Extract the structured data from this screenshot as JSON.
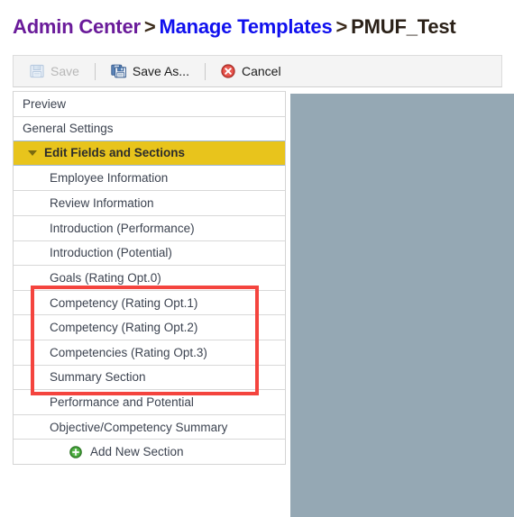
{
  "breadcrumb": {
    "root": "Admin Center",
    "separator": ">",
    "middle": "Manage Templates",
    "current": "PMUF_Test",
    "colors": {
      "root": "#6a1b9a",
      "middle": "#1010ee",
      "current": "#2b2118"
    }
  },
  "toolbar": {
    "save_label": "Save",
    "save_enabled": "false",
    "save_as_label": "Save As...",
    "cancel_label": "Cancel",
    "icons": {
      "save": "floppy-disk-icon",
      "save_as": "double-floppy-disk-icon",
      "cancel": "red-circle-x-icon"
    }
  },
  "section_list": {
    "items": [
      {
        "label": "Preview",
        "indent": "false",
        "active": "false"
      },
      {
        "label": "General Settings",
        "indent": "false",
        "active": "false"
      },
      {
        "label": "Edit Fields and Sections",
        "indent": "false",
        "active": "true"
      },
      {
        "label": "Employee Information",
        "indent": "true",
        "active": "false"
      },
      {
        "label": "Review Information",
        "indent": "true",
        "active": "false"
      },
      {
        "label": "Introduction (Performance)",
        "indent": "true",
        "active": "false"
      },
      {
        "label": "Introduction (Potential)",
        "indent": "true",
        "active": "false"
      },
      {
        "label": "Goals (Rating Opt.0)",
        "indent": "true",
        "active": "false"
      },
      {
        "label": "Competency (Rating Opt.1)",
        "indent": "true",
        "active": "false"
      },
      {
        "label": "Competency (Rating Opt.2)",
        "indent": "true",
        "active": "false"
      },
      {
        "label": "Competencies (Rating Opt.3)",
        "indent": "true",
        "active": "false"
      },
      {
        "label": "Summary Section",
        "indent": "true",
        "active": "false"
      },
      {
        "label": "Performance and Potential",
        "indent": "true",
        "active": "false"
      },
      {
        "label": "Objective/Competency Summary",
        "indent": "true",
        "active": "false"
      }
    ],
    "add_new_label": "Add New Section",
    "add_new_icon": "green-circle-plus-icon",
    "active_row_color": "#e8c41c"
  },
  "annotation": {
    "color": "#f4443e",
    "highlighted_items": [
      "Goals (Rating Opt.0)",
      "Competency (Rating Opt.1)",
      "Competency (Rating Opt.2)",
      "Competencies (Rating Opt.3)"
    ]
  },
  "redacted_panel": {
    "color": "#95a8b4"
  }
}
